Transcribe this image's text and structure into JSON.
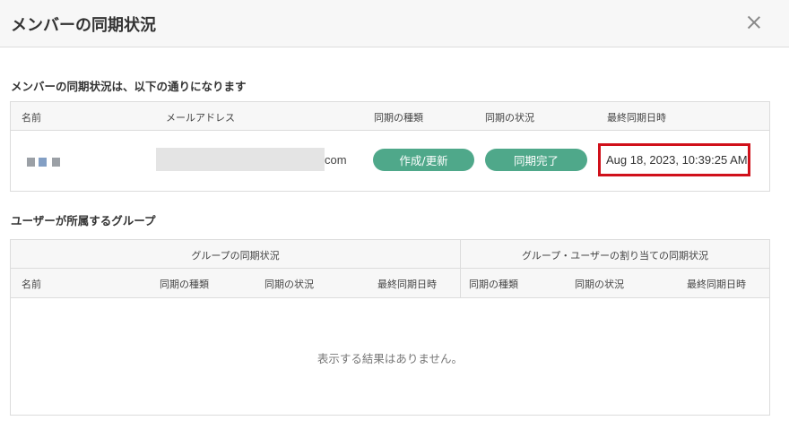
{
  "dialog": {
    "title": "メンバーの同期状況",
    "close_icon": "close-icon"
  },
  "member_section": {
    "title": "メンバーの同期状況は、以下の通りになります",
    "columns": [
      "名前",
      "メールアドレス",
      "同期の種類",
      "同期の状況",
      "最終同期日時"
    ],
    "row": {
      "email_suffix": "com",
      "sync_type": "作成/更新",
      "sync_status": "同期完了",
      "last_synced": "Aug 18, 2023, 10:39:25 AM"
    }
  },
  "group_section": {
    "title": "ユーザーが所属するグループ",
    "group_sync_header": "グループの同期状況",
    "assignment_sync_header": "グループ・ユーザーの割り当ての同期状況",
    "columns_left": [
      "名前",
      "同期の種類",
      "同期の状況",
      "最終同期日時"
    ],
    "columns_right": [
      "同期の種類",
      "同期の状況",
      "最終同期日時"
    ],
    "empty_message": "表示する結果はありません。"
  },
  "colors": {
    "pill_green": "#4fa88a",
    "highlight_red": "#d0101a"
  }
}
